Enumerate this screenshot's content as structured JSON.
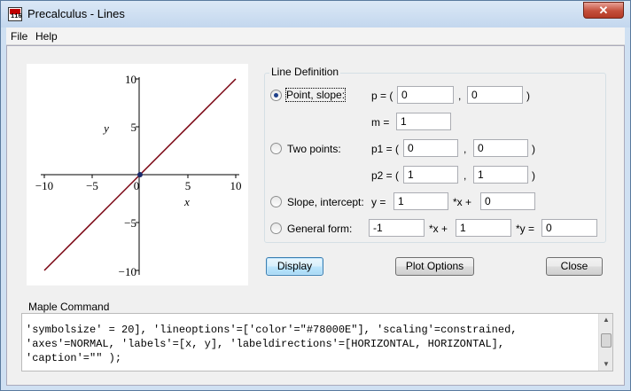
{
  "window": {
    "title": "Precalculus - Lines",
    "close_symbol": "✕",
    "icon_text": "116"
  },
  "menu": {
    "items": [
      "File",
      "Help"
    ]
  },
  "plot": {
    "x_ticks": [
      "−10",
      "−5",
      "0",
      "5",
      "10"
    ],
    "y_ticks": [
      "10",
      "5",
      "−5",
      "−10"
    ],
    "x_label": "x",
    "y_label": "y",
    "line_color": "#78000E",
    "point_color": "#1a2a6c",
    "xlim": [
      -10,
      10
    ],
    "ylim": [
      -10,
      10
    ],
    "line": {
      "p": [
        0,
        0
      ],
      "m": 1
    }
  },
  "line_definition": {
    "legend": "Line Definition",
    "point_slope": {
      "option": "Point, slope:",
      "selected": true,
      "p_label": "p = (",
      "p_x": "0",
      "comma": ",",
      "p_y": "0",
      "close": ")",
      "m_label": "m =",
      "m": "1"
    },
    "two_points": {
      "option": "Two points:",
      "selected": false,
      "p1_label": "p1 = (",
      "p1_x": "0",
      "p1_comma": ",",
      "p1_y": "0",
      "p1_close": ")",
      "p2_label": "p2 = (",
      "p2_x": "1",
      "p2_comma": ",",
      "p2_y": "1",
      "p2_close": ")"
    },
    "slope_intercept": {
      "option": "Slope, intercept:",
      "selected": false,
      "y_label": "y =",
      "slope": "1",
      "x_plus": "*x +",
      "intercept": "0"
    },
    "general_form": {
      "option": "General form:",
      "selected": false,
      "a": "-1",
      "x_plus": "*x +",
      "b": "1",
      "y_eq": "*y =",
      "c": "0"
    }
  },
  "buttons": {
    "display": "Display",
    "plot_options": "Plot Options",
    "close": "Close"
  },
  "maple": {
    "legend": "Maple Command",
    "lines": [
      "'symbolsize' = 20], 'lineoptions'=['color'=\"#78000E\"], 'scaling'=constrained,",
      "'axes'=NORMAL, 'labels'=[x, y], 'labeldirections'=[HORIZONTAL, HORIZONTAL],",
      "'caption'=\"\" );"
    ]
  }
}
